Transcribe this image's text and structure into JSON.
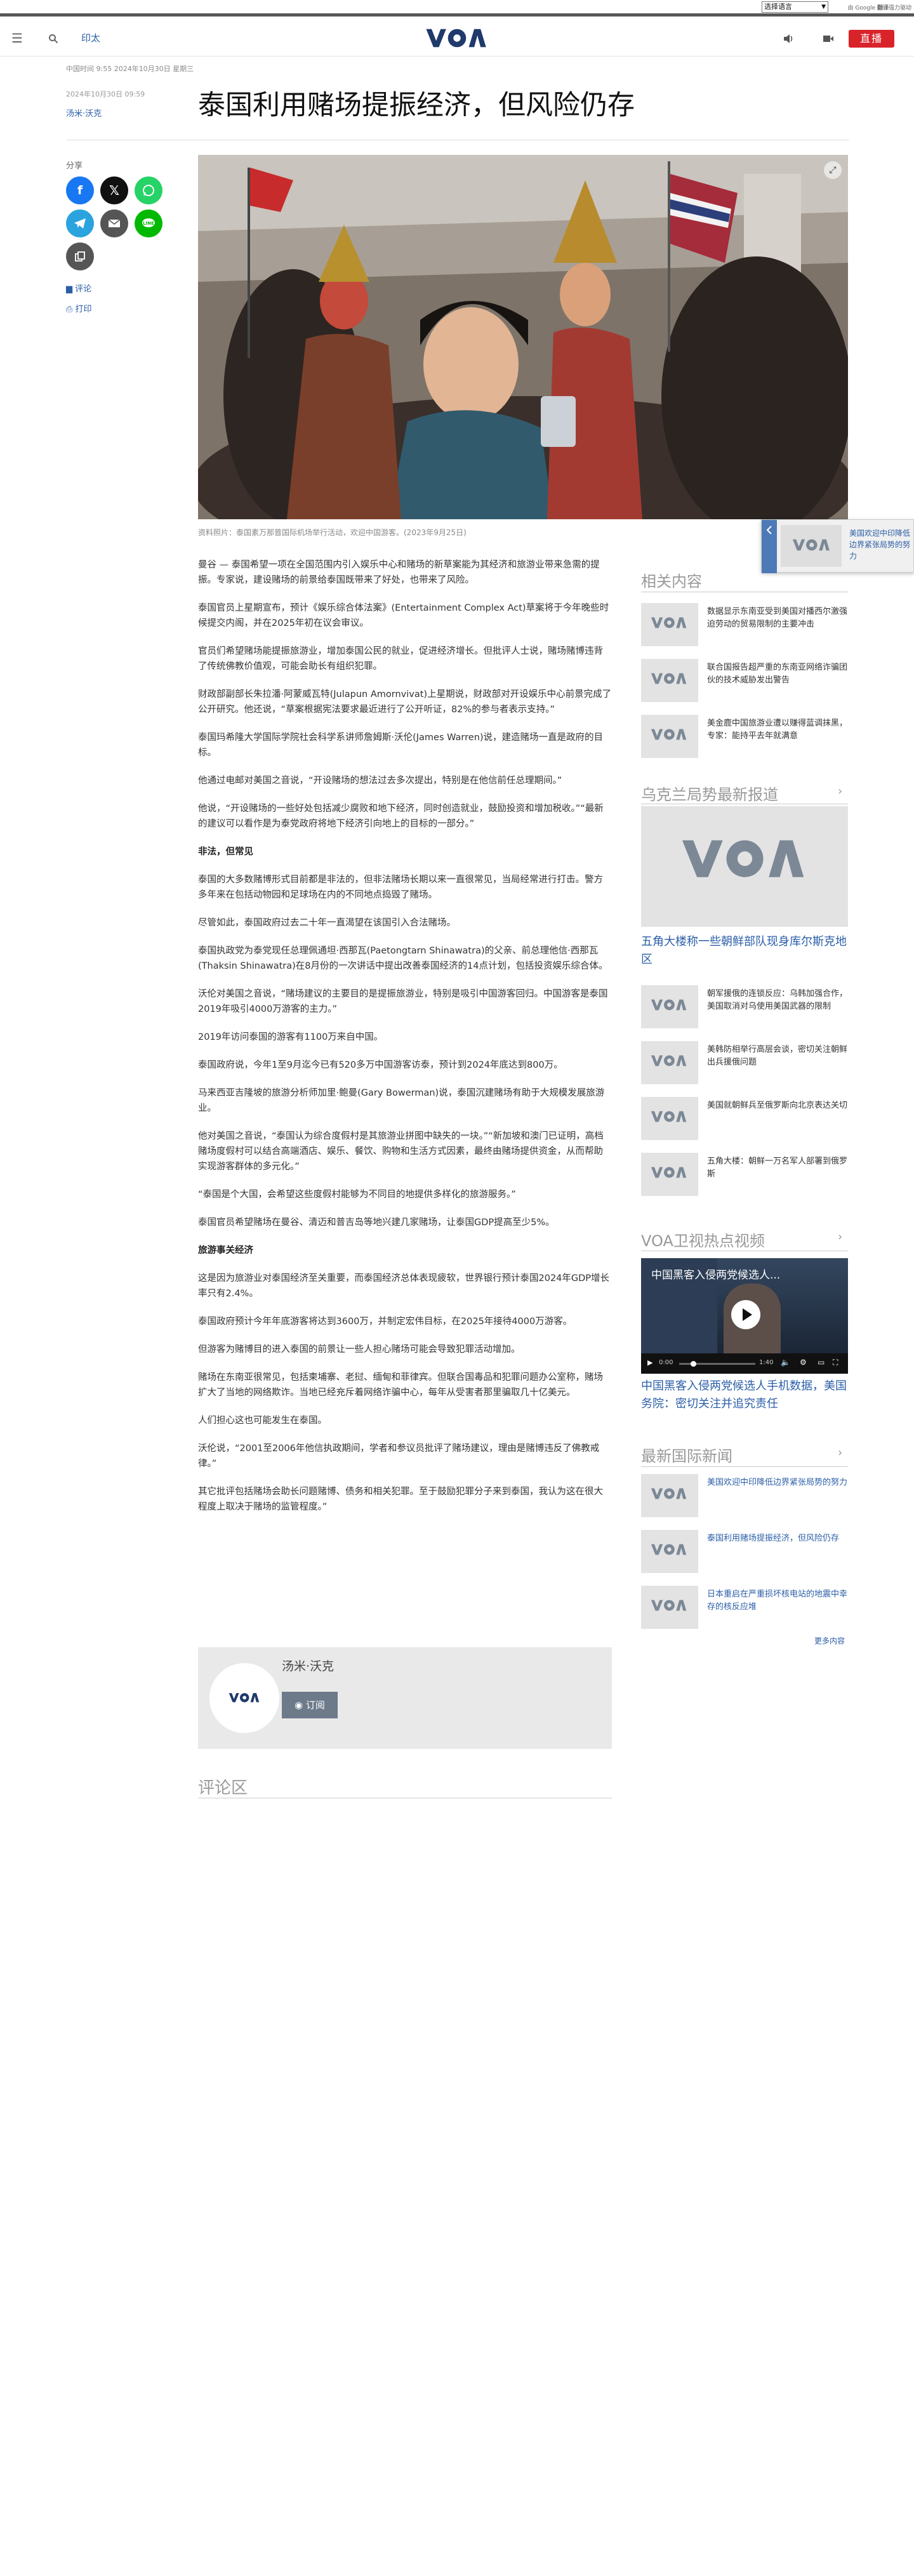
{
  "translate_bar": {
    "select_label": "选择语言",
    "powered_prefix": "由 Google",
    "powered_suffix": "翻译强力驱动",
    "powered_bold": "翻译"
  },
  "header": {
    "category": "印太",
    "live_label": "直播"
  },
  "article": {
    "dateline": "中国时间 9:55 2024年10月30日 星期三",
    "published": "2024年10月30日 09:59",
    "author": "汤米·沃克",
    "title": "泰国利用赌场提振经济，但风险仍存",
    "caption": "资料照片：泰国素万那普国际机场举行活动，欢迎中国游客。(2023年9月25日)",
    "paragraphs": [
      {
        "text": "曼谷 — 泰国希望一项在全国范围内引入娱乐中心和赌场的新草案能为其经济和旅游业带来急需的提振。专家说，建设赌场的前景给泰国既带来了好处，也带来了风险。",
        "heading": false
      },
      {
        "text": "泰国官员上星期宣布，预计《娱乐综合体法案》(Entertainment Complex Act)草案将于今年晚些时候提交内阁，并在2025年初在议会审议。",
        "heading": false
      },
      {
        "text": "官员们希望赌场能提振旅游业，增加泰国公民的就业，促进经济增长。但批评人士说，赌场赌博违背了传统佛教价值观，可能会助长有组织犯罪。",
        "heading": false
      },
      {
        "text": "财政部副部长朱拉潘·阿蒙威瓦特(Julapun Amornvivat)上星期说，财政部对开设娱乐中心前景完成了公开研究。他还说，“草案根据宪法要求最近进行了公开听证，82%的参与者表示支持。”",
        "heading": false
      },
      {
        "text": "泰国玛希隆大学国际学院社会科学系讲师詹姆斯·沃伦(James Warren)说，建造赌场一直是政府的目标。",
        "heading": false
      },
      {
        "text": "他通过电邮对美国之音说，“开设赌场的想法过去多次提出，特别是在他信前任总理期间。”",
        "heading": false
      },
      {
        "text": "他说，“开设赌场的一些好处包括减少腐败和地下经济，同时创造就业，鼓励投资和增加税收。”“最新的建议可以看作是为泰党政府将地下经济引向地上的目标的一部分。”",
        "heading": false
      },
      {
        "text": "非法，但常见",
        "heading": true
      },
      {
        "text": "泰国的大多数赌博形式目前都是非法的，但非法赌场长期以来一直很常见，当局经常进行打击。警方多年来在包括动物园和足球场在内的不同地点捣毁了赌场。",
        "heading": false
      },
      {
        "text": "尽管如此，泰国政府过去二十年一直渴望在该国引入合法赌场。",
        "heading": false
      },
      {
        "text": "泰国执政党为泰党现任总理佩通坦·西那瓦(Paetongtarn Shinawatra)的父亲、前总理他信·西那瓦(Thaksin Shinawatra)在8月份的一次讲话中提出改善泰国经济的14点计划，包括投资娱乐综合体。",
        "heading": false
      },
      {
        "text": "沃伦对美国之音说，“赌场建议的主要目的是提振旅游业，特别是吸引中国游客回归。中国游客是泰国2019年吸引4000万游客的主力。”",
        "heading": false
      },
      {
        "text": "2019年访问泰国的游客有1100万来自中国。",
        "heading": false
      },
      {
        "text": "泰国政府说，今年1至9月迄今已有520多万中国游客访泰，预计到2024年底达到800万。",
        "heading": false
      },
      {
        "text": "马来西亚吉隆坡的旅游分析师加里·鲍曼(Gary Bowerman)说，泰国沉建赌场有助于大规模发展旅游业。",
        "heading": false
      },
      {
        "text": "他对美国之音说，“泰国认为综合度假村是其旅游业拼图中缺失的一块。”“新加坡和澳门已证明，高档赌场度假村可以结合高端酒店、娱乐、餐饮、购物和生活方式因素，最终由赌场提供资金，从而帮助实现游客群体的多元化。”",
        "heading": false
      },
      {
        "text": "“泰国是个大国，会希望这些度假村能够为不同目的地提供多样化的旅游服务。”",
        "heading": false
      },
      {
        "text": "泰国官员希望赌场在曼谷、清迈和普吉岛等地兴建几家赌场，让泰国GDP提高至少5%。",
        "heading": false
      },
      {
        "text": "旅游事关经济",
        "heading": true
      },
      {
        "text": "这是因为旅游业对泰国经济至关重要，而泰国经济总体表现疲软，世界银行预计泰国2024年GDP增长率只有2.4%。",
        "heading": false
      },
      {
        "text": "泰国政府预计今年年底游客将达到3600万，并制定宏伟目标，在2025年接待4000万游客。",
        "heading": false
      },
      {
        "text": "但游客为赌博目的进入泰国的前景让一些人担心赌场可能会导致犯罪活动增加。",
        "heading": false
      },
      {
        "text": "赌场在东南亚很常见，包括柬埔寨、老挝、缅甸和菲律宾。但联合国毒品和犯罪问题办公室称，赌场扩大了当地的网络欺诈。当地已经充斥着网络诈骗中心，每年从受害者那里骗取几十亿美元。",
        "heading": false
      },
      {
        "text": "人们担心这也可能发生在泰国。",
        "heading": false
      },
      {
        "text": "沃伦说，“2001至2006年他信执政期间，学者和参议员批评了赌场建议，理由是赌博违反了佛教戒律。”",
        "heading": false
      },
      {
        "text": "其它批评包括赌场会助长问题赌博、债务和相关犯罪。至于鼓励犯罪分子来到泰国，我认为这在很大程度上取决于赌场的监管程度。”",
        "heading": false
      }
    ],
    "author_box": {
      "name": "汤米·沃克",
      "subscribe": "订阅"
    },
    "comments_title": "评论区"
  },
  "share": {
    "label": "分享",
    "comments_link": "评论",
    "print_link": "打印"
  },
  "sidebar": {
    "related": {
      "title": "相关内容",
      "items": [
        "数据显示东南亚受到美国对播西尔激强迫劳动的贸易限制的主要冲击",
        "联合国报告超严重的东南亚网络诈骗团伙的技术威胁发出警告",
        "美金鹿中国旅游业遭以赚得蓝调抹黑，专家：能持平去年就满意"
      ]
    },
    "ukraine": {
      "title": "乌克兰局势最新报道",
      "featured": "五角大楼称一些朝鲜部队现身库尔斯克地区",
      "items": [
        "朝军援俄的连锁反应：乌韩加强合作，美国取消对乌使用美国武器的限制",
        "美韩防相举行高层会谈，密切关注朝鲜出兵援俄问题",
        "美国就朝鲜兵至俄罗斯向北京表达关切",
        "五角大楼：朝鲜一万名军人部署到俄罗斯"
      ]
    },
    "video": {
      "title": "VOA卫视热点视频",
      "overlay": "中国黑客入侵两党候选人...",
      "time": "0:00",
      "duration": "1:40",
      "caption": "中国黑客入侵两党候选人手机数据，美国务院：密切关注并追究责任"
    },
    "intl": {
      "title": "最新国际新闻",
      "items": [
        "美国欢迎中印降低边界紧张局势的努力",
        "泰国利用赌场提振经济，但风险仍存",
        "日本重启在严重损坏核电站的地震中幸存的核反应堆"
      ],
      "more": "更多内容"
    }
  },
  "floating": {
    "text": "美国欢迎中印降低边界紧张局势的努力"
  },
  "colors": {
    "accent": "#2b5ea8",
    "live": "#d9232a",
    "logo": "#1f3a6b"
  }
}
